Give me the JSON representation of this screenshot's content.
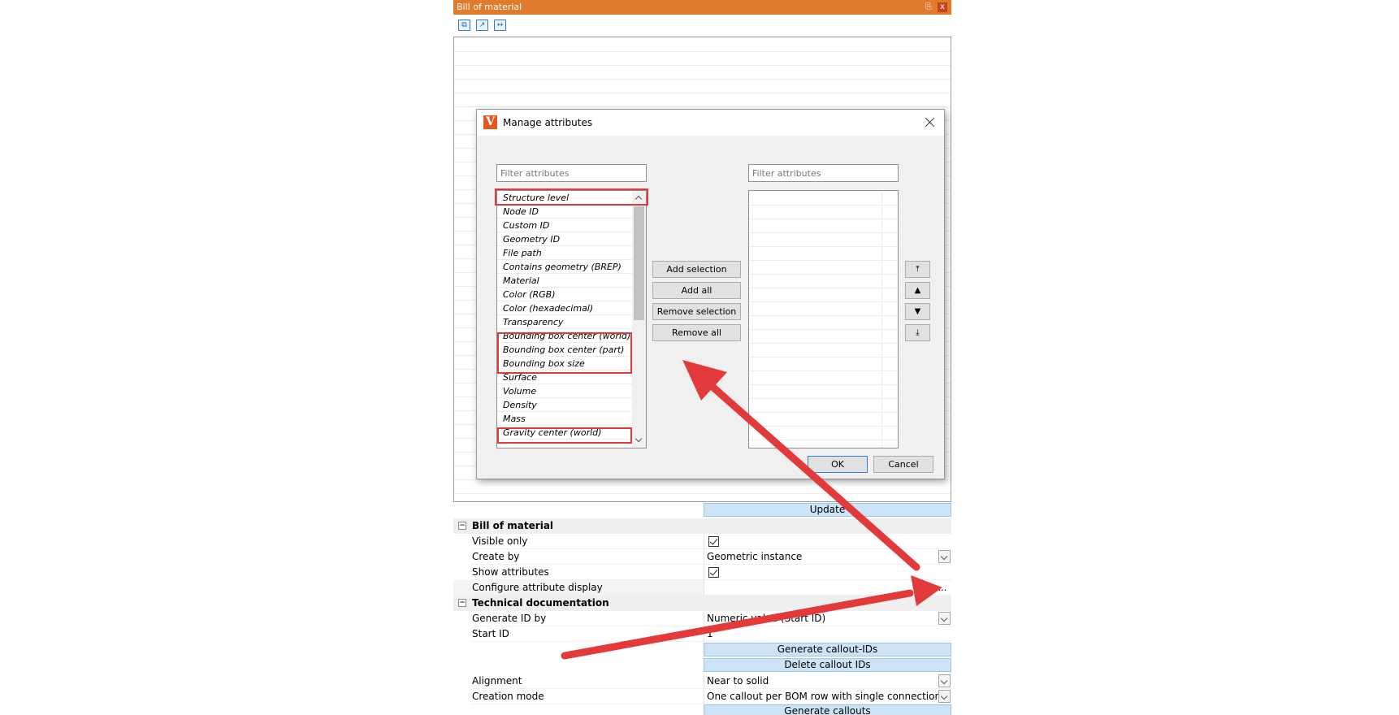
{
  "panel": {
    "title": "Bill of material",
    "pin_glyph": "✓",
    "close_glyph": "x",
    "toolbar_icons": [
      "copy-icon",
      "export-icon",
      "fit-columns-icon"
    ]
  },
  "dialog": {
    "title": "Manage attributes",
    "logo_letter": "V",
    "left_filter_placeholder": "Filter attributes",
    "right_filter_placeholder": "Filter attributes",
    "left_items": [
      "Structure level",
      "Node ID",
      "Custom ID",
      "Geometry ID",
      "File path",
      "Contains geometry (BREP)",
      "Material",
      "Color (RGB)",
      "Color (hexadecimal)",
      "Transparency",
      "Bounding box center (world)",
      "Bounding box center (part)",
      "Bounding box size",
      "Surface",
      "Volume",
      "Density",
      "Mass",
      "Gravity center (world)"
    ],
    "buttons": {
      "add_selection": "Add selection",
      "add_all": "Add all",
      "remove_selection": "Remove selection",
      "remove_all": "Remove all",
      "ok": "OK",
      "cancel": "Cancel"
    },
    "order_buttons": [
      "⤒",
      "▲",
      "▼",
      "⤓"
    ]
  },
  "properties": {
    "update_button": "Update",
    "bom_section": "Bill of material",
    "visible_only": "Visible only",
    "create_by": "Create by",
    "create_by_value": "Geometric instance",
    "show_attributes": "Show attributes",
    "configure_attribute_display": "Configure attribute display",
    "configure_ellipsis": "...",
    "tech_section": "Technical documentation",
    "generate_id_by": "Generate ID by",
    "generate_id_by_value": "Numeric value (Start ID)",
    "start_id": "Start ID",
    "start_id_value": "1",
    "generate_callout_ids": "Generate callout-IDs",
    "delete_callout_ids": "Delete callout IDs",
    "alignment": "Alignment",
    "alignment_value": "Near to solid",
    "creation_mode": "Creation mode",
    "creation_mode_value": "One callout per BOM row with single connection",
    "generate_callouts": "Generate callouts"
  },
  "colors": {
    "titlebar": "#e07a2c",
    "annotation_red": "#e23a3a",
    "band_button": "#cde4f7",
    "ok_border": "#2f7fd8"
  }
}
